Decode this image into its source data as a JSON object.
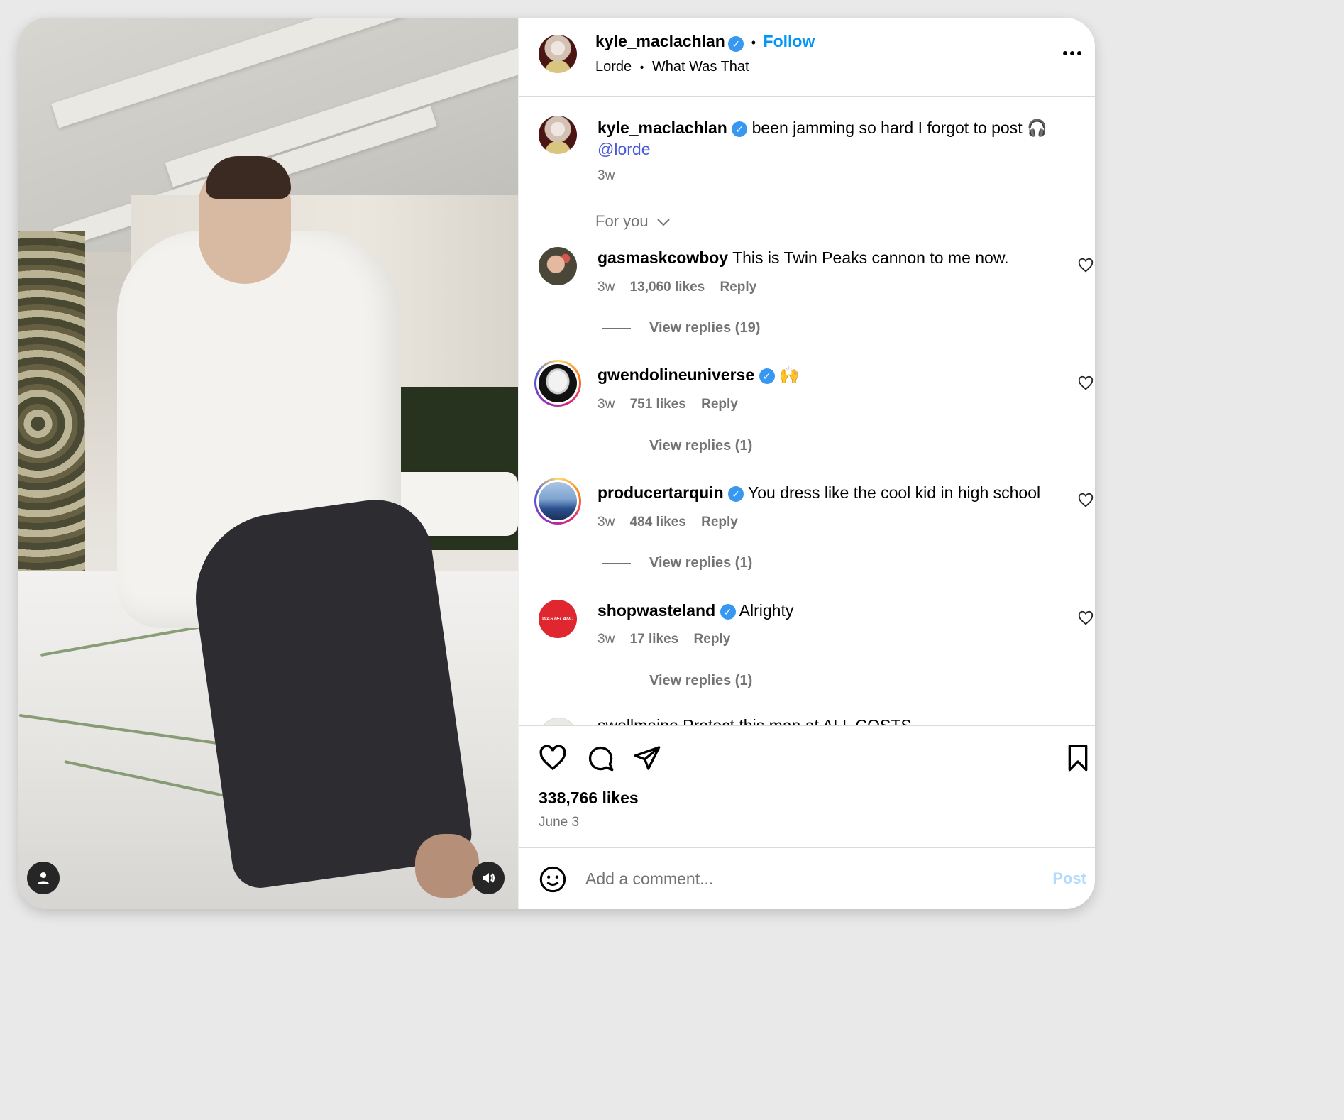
{
  "post": {
    "username": "kyle_maclachlan",
    "follow_label": "Follow",
    "dot": "•",
    "audio": {
      "artist": "Lorde",
      "track": "What Was That"
    },
    "caption_text": "been jamming so hard I forgot to post 🎧",
    "caption_mention": "@lorde",
    "caption_time": "3w",
    "sort_label": "For you",
    "likes": "338,766 likes",
    "date": "June 3"
  },
  "comments": [
    {
      "username": "gasmaskcowboy",
      "verified": false,
      "text": "This is Twin Peaks cannon to me now.",
      "time": "3w",
      "likes": "13,060 likes",
      "reply": "Reply",
      "view_replies": "View replies (19)"
    },
    {
      "username": "gwendolineuniverse",
      "verified": true,
      "text": "🙌",
      "time": "3w",
      "likes": "751 likes",
      "reply": "Reply",
      "view_replies": "View replies (1)"
    },
    {
      "username": "producertarquin",
      "verified": true,
      "text": "You dress like the cool kid in high school",
      "time": "3w",
      "likes": "484 likes",
      "reply": "Reply",
      "view_replies": "View replies (1)"
    },
    {
      "username": "shopwasteland",
      "verified": true,
      "text": "Alrighty",
      "time": "3w",
      "likes": "17 likes",
      "reply": "Reply",
      "view_replies": "View replies (1)"
    }
  ],
  "partial_comment": "swellmaine Protect this man at ALL COSTS",
  "add_comment": {
    "placeholder": "Add a comment...",
    "post_label": "Post"
  },
  "wasteland_logo_text": "WASTELAND",
  "icons": {
    "verified": "verified-badge-icon",
    "more": "more-options-icon",
    "chevron": "chevron-down-icon",
    "heart": "heart-icon",
    "comment": "comment-icon",
    "share": "share-icon",
    "bookmark": "bookmark-icon",
    "emoji": "emoji-icon",
    "user": "user-tag-icon",
    "volume": "volume-icon"
  },
  "colors": {
    "link_blue": "#0095f6",
    "mention": "#00376b",
    "verified": "#3897f0",
    "muted": "#737373"
  }
}
